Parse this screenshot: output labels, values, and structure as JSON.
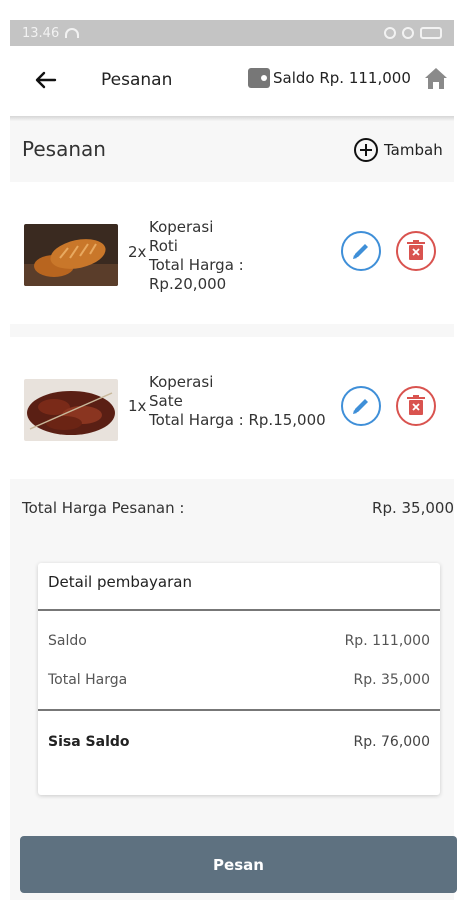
{
  "status_bar": {
    "time": "13.46"
  },
  "appbar": {
    "title": "Pesanan",
    "saldo": "Saldo Rp. 111,000"
  },
  "section": {
    "title": "Pesanan",
    "add_label": "Tambah"
  },
  "orders": [
    {
      "qty": "2x",
      "line1": "Koperasi",
      "line2": "Roti",
      "line3": "Total Harga :",
      "line4": "Rp.20,000"
    },
    {
      "qty": "1x",
      "line1": "Koperasi",
      "line2": "Sate",
      "line3": "Total Harga : Rp.15,000",
      "line4": ""
    }
  ],
  "total": {
    "label": "Total Harga Pesanan :",
    "value": "Rp. 35,000"
  },
  "payment": {
    "title": "Detail pembayaran",
    "rows": [
      {
        "label": "Saldo",
        "value": "Rp. 111,000"
      },
      {
        "label": "Total Harga",
        "value": "Rp. 35,000"
      },
      {
        "label": "Sisa Saldo",
        "value": "Rp. 76,000"
      }
    ]
  },
  "submit_label": "Pesan",
  "colors": {
    "edit": "#3f8fd8",
    "delete": "#d9534f",
    "submit": "#5e7180"
  }
}
